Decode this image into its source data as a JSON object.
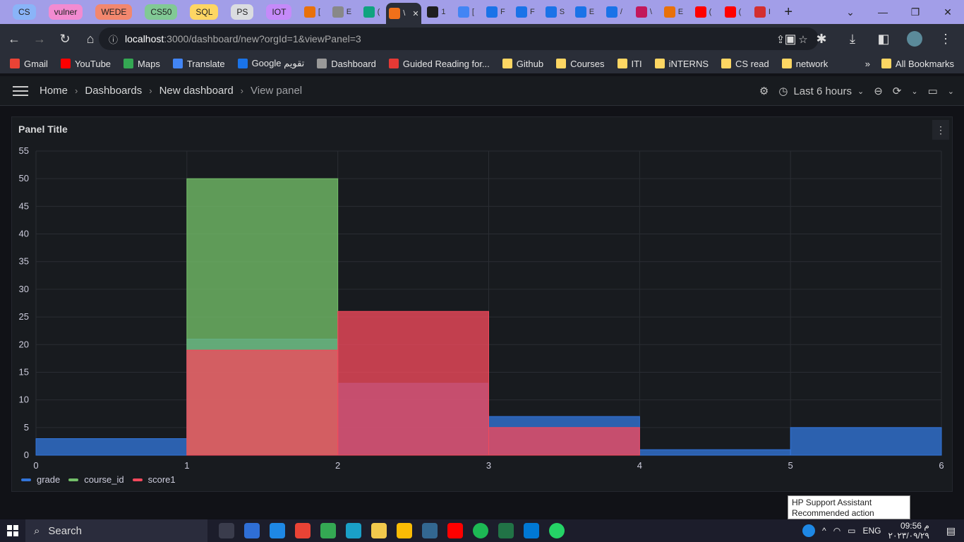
{
  "browser": {
    "tab_groups": [
      {
        "label": "CS",
        "color": "#8ab4f8"
      },
      {
        "label": "vulner",
        "color": "#f28bd1"
      },
      {
        "label": "WEDE",
        "color": "#f2876e"
      },
      {
        "label": "CS50",
        "color": "#81c995"
      },
      {
        "label": "SQL",
        "color": "#fdd663"
      },
      {
        "label": "PS",
        "color": "#dadce0"
      },
      {
        "label": "IOT",
        "color": "#c58af9"
      }
    ],
    "tabs": [
      {
        "label": "[",
        "favicon_color": "#e8710a"
      },
      {
        "label": "E",
        "favicon_color": "#888"
      },
      {
        "label": "(",
        "favicon_color": "#10a37f"
      },
      {
        "label": "\\",
        "favicon_color": "#f0701a",
        "active": true
      },
      {
        "label": "1",
        "favicon_color": "#1f1f1f"
      },
      {
        "label": "[",
        "favicon_color": "#4285f4"
      },
      {
        "label": "F",
        "favicon_color": "#1a73e8"
      },
      {
        "label": "F",
        "favicon_color": "#1a73e8"
      },
      {
        "label": "S",
        "favicon_color": "#1a73e8"
      },
      {
        "label": "E",
        "favicon_color": "#1a73e8"
      },
      {
        "label": "/",
        "favicon_color": "#1a73e8"
      },
      {
        "label": "\\",
        "favicon_color": "#c2185b"
      },
      {
        "label": "E",
        "favicon_color": "#e8710a"
      },
      {
        "label": "(",
        "favicon_color": "#ff0000"
      },
      {
        "label": "(",
        "favicon_color": "#ff0000"
      },
      {
        "label": "I",
        "favicon_color": "#d32f2f"
      }
    ],
    "active_tab_close": "✕",
    "new_tab": "+",
    "url_host": "localhost",
    "url_path": ":3000/dashboard/new?orgId=1&viewPanel=3"
  },
  "bookmarks": {
    "items": [
      {
        "label": "Gmail",
        "color": "#ea4335"
      },
      {
        "label": "YouTube",
        "color": "#ff0000"
      },
      {
        "label": "Maps",
        "color": "#34a853"
      },
      {
        "label": "Translate",
        "color": "#4285f4"
      },
      {
        "label": "Google تقويم",
        "color": "#1a73e8"
      },
      {
        "label": "Dashboard",
        "color": "#999"
      },
      {
        "label": "Guided Reading for...",
        "color": "#e53935"
      },
      {
        "label": "Github",
        "color": "#fdd663"
      },
      {
        "label": "Courses",
        "color": "#fdd663"
      },
      {
        "label": "ITI",
        "color": "#fdd663"
      },
      {
        "label": "iNTERNS",
        "color": "#fdd663"
      },
      {
        "label": "CS read",
        "color": "#fdd663"
      },
      {
        "label": "network",
        "color": "#fdd663"
      }
    ],
    "overflow": "»",
    "all_bookmarks": "All Bookmarks"
  },
  "grafana": {
    "breadcrumbs": [
      "Home",
      "Dashboards",
      "New dashboard",
      "View panel"
    ],
    "time_range": "Last 6 hours"
  },
  "panel": {
    "title": "Panel Title"
  },
  "chart_data": {
    "type": "bar",
    "bins": [
      0,
      1,
      2,
      3,
      4,
      5,
      6
    ],
    "xlim": [
      0,
      6
    ],
    "ylim": [
      0,
      55
    ],
    "yticks": [
      0,
      5,
      10,
      15,
      20,
      25,
      30,
      35,
      40,
      45,
      50,
      55
    ],
    "xticks": [
      0,
      1,
      2,
      3,
      4,
      5,
      6
    ],
    "grid": true,
    "legend_placement": "bottom-left",
    "series": [
      {
        "name": "grade",
        "color": "#3274d9",
        "values": [
          3,
          21,
          13,
          7,
          1,
          5
        ]
      },
      {
        "name": "course_id",
        "color": "#73bf69",
        "values": [
          0,
          50,
          0,
          0,
          0,
          0
        ]
      },
      {
        "name": "score1",
        "color": "#f2495c",
        "values": [
          0,
          19,
          26,
          5,
          0,
          0
        ]
      }
    ]
  },
  "tooltip": {
    "line1": "HP Support Assistant",
    "line2": "Recommended action needed."
  },
  "taskbar": {
    "search": "Search",
    "lang": "ENG",
    "time": "09:56 م",
    "date": "٢٠٢٣/٠٩/٢٩"
  }
}
